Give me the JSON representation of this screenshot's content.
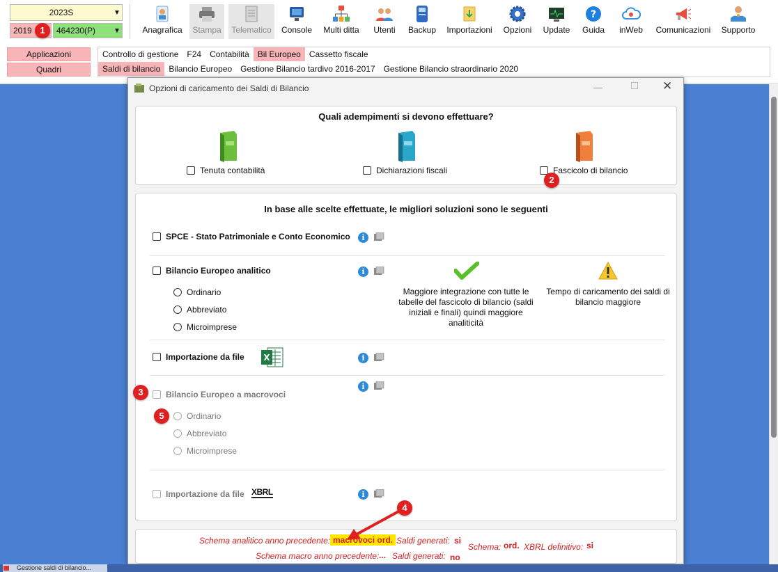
{
  "topbar": {
    "period_select": "2023S",
    "year_select": "2019",
    "company_select": "464230(P)",
    "toolbar": [
      {
        "label": "Anagrafica",
        "icon": "id-card-icon",
        "disabled": false
      },
      {
        "label": "Stampa",
        "icon": "printer-icon",
        "disabled": true
      },
      {
        "label": "Telematico",
        "icon": "document-icon",
        "disabled": true
      },
      {
        "label": "Console",
        "icon": "monitor-icon",
        "disabled": false
      },
      {
        "label": "Multi ditta",
        "icon": "hierarchy-icon",
        "disabled": false
      },
      {
        "label": "Utenti",
        "icon": "users-icon",
        "disabled": false
      },
      {
        "label": "Backup",
        "icon": "backup-icon",
        "disabled": false
      },
      {
        "label": "Importazioni",
        "icon": "import-icon",
        "disabled": false
      },
      {
        "label": "Opzioni",
        "icon": "gear-icon",
        "disabled": false
      },
      {
        "label": "Update",
        "icon": "update-icon",
        "disabled": false
      },
      {
        "label": "Guida",
        "icon": "help-icon",
        "disabled": false
      },
      {
        "label": "inWeb",
        "icon": "cloud-icon",
        "disabled": false
      },
      {
        "label": "Comunicazioni",
        "icon": "megaphone-icon",
        "disabled": false
      },
      {
        "label": "Supporto",
        "icon": "support-icon",
        "disabled": false
      }
    ],
    "side_buttons": {
      "applicazioni": "Applicazioni",
      "quadri": "Quadri"
    },
    "menu_row1": [
      "Controllo di gestione",
      "F24",
      "Contabilità",
      "Bil Europeo",
      "Cassetto fiscale"
    ],
    "menu_row2": [
      "Saldi di bilancio",
      "Bilancio Europeo",
      "Gestione Bilancio tardivo 2016-2017",
      "Gestione Bilancio straordinario 2020"
    ]
  },
  "dialog": {
    "title": "Opzioni di caricamento dei Saldi di Bilancio",
    "section1": {
      "heading": "Quali adempimenti si devono effettuare?",
      "options": [
        "Tenuta contabilità",
        "Dichiarazioni fiscali",
        "Fascicolo di bilancio"
      ]
    },
    "section2": {
      "heading": "In base alle scelte effettuate, le migliori soluzioni sono le seguenti",
      "spce": "SPCE  -  Stato Patrimoniale e Conto Economico",
      "bil_analitico": "Bilancio Europeo analitico",
      "radios_analitico": [
        "Ordinario",
        "Abbreviato",
        "Microimprese"
      ],
      "pro_text": "Maggiore integrazione con tutte le tabelle del fascicolo di bilancio (saldi iniziali e finali) quindi maggiore analiticità",
      "con_text": "Tempo di caricamento dei saldi di bilancio maggiore",
      "import_file": "Importazione da file",
      "bil_macro": "Bilancio Europeo a macrovoci",
      "radios_macro": [
        "Ordinario",
        "Abbreviato",
        "Microimprese"
      ],
      "import_xbrl": "Importazione da file",
      "xbrl_logo": "XBRL"
    },
    "footer": {
      "schema_analitico_label": "Schema analitico anno precedente:",
      "schema_analitico_value": "macrovoci ord.",
      "saldi1_label": "Saldi generati:",
      "saldi1_value": "si",
      "schema_label": "Schema:",
      "schema_value": "ord.",
      "xbrl_label": "XBRL definitivo:",
      "xbrl_value": "si",
      "schema_macro_label": "Schema macro anno precedente:",
      "schema_macro_value": "...",
      "saldi2_label": "Saldi generati:",
      "saldi2_value": "no"
    }
  },
  "annotations": [
    "1",
    "2",
    "3",
    "4",
    "5"
  ],
  "statusbar": {
    "task": "Gestione saldi di bilancio..."
  },
  "colors": {
    "workspace": "#4a7fd1",
    "pink": "#f8b5b8",
    "green": "#8ee07a",
    "annotation_red": "#e02020",
    "footer_red": "#d62020",
    "highlight": "#ffe600"
  }
}
